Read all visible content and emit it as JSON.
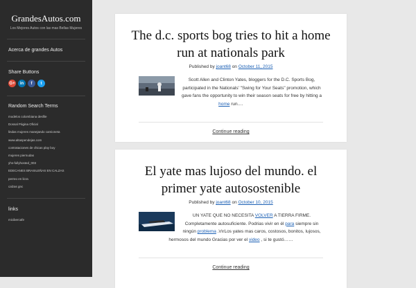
{
  "site": {
    "title": "GrandesAutos.com",
    "tagline": "Los Mejores Autos con las mas Bellas Mujeres"
  },
  "sidebar": {
    "about_link": "Acerca de grandes Autos",
    "share_title": "Share Buttons",
    "share_buttons": [
      {
        "label": "G+",
        "icon": "google-plus-icon",
        "color": "#dd4b39"
      },
      {
        "label": "in",
        "icon": "linkedin-icon",
        "color": "#0077b5"
      },
      {
        "label": "f",
        "icon": "facebook-icon",
        "color": "#3b5998"
      },
      {
        "label": "t",
        "icon": "twitter-icon",
        "color": "#1da1f2"
      }
    ],
    "search_terms_title": "Random Search Terms",
    "search_terms": [
      "modelos colombiana desfile",
      "Dossal Página Oficial",
      "lindas mujeres manejando camioneta",
      "www.altaspendejas.com",
      "contrataciones de chicas play boy",
      "mujeres piernudas",
      "yhs-fullyhosted_003",
      "EDECANES BRASILEÑAS EN CALZAS",
      "perreo en licra",
      "calzas gnc"
    ],
    "links_title": "links",
    "links": [
      "micibercafe"
    ]
  },
  "posts": [
    {
      "title": "The d.c. sports bog tries to hit a home run at nationals park",
      "meta_prefix": "Published by",
      "author": "joant68",
      "meta_on": "on",
      "date": "October 11, 2015",
      "excerpt_before": "Scott Allen and Clinton Yates, bloggers for the D.C. Sports Bog, participated in the Nationals' \"Swing for Your Seats\" promotion, which gave fans the opportunity to win their season seats for free by hitting a",
      "excerpt_link": "home",
      "excerpt_after": "run.…",
      "continue": "Continue reading"
    },
    {
      "title": "El yate mas lujoso del mundo. el primer yate autosostenible",
      "meta_prefix": "Published by",
      "author": "joant68",
      "meta_on": "on",
      "date": "October 10, 2015",
      "excerpt_p1": "UN YATE QUE NO NECESITA",
      "excerpt_l1": "VOLVER",
      "excerpt_p2": "A TIERRA FIRME. Completamente autosuficiente. Podrias vivir en él",
      "excerpt_l2": "para",
      "excerpt_p3": "siempre sin ningún",
      "excerpt_l3": "problema",
      "excerpt_p4": ".\\r\\rLos yates mas caros, costosos, bonitos, lujosos, hermosos del mundo Gracias por ver el",
      "excerpt_l4": "video",
      "excerpt_p5": ", si te gustó……",
      "continue": "Continue reading"
    }
  ],
  "colors": {
    "sidebar_bg": "#2b2b2b",
    "page_bg": "#e8e8e8",
    "link": "#1a5fb4"
  }
}
